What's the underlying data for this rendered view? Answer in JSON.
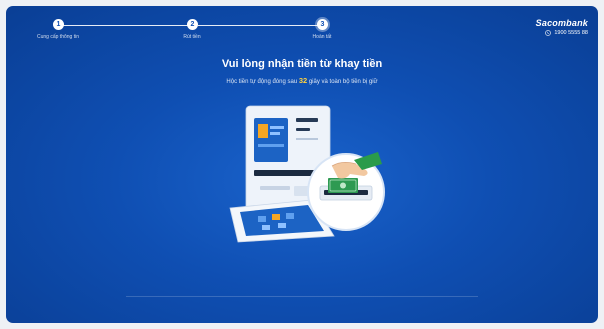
{
  "stepper": {
    "steps": [
      {
        "number": "1",
        "label": "Cung cấp thông tin"
      },
      {
        "number": "2",
        "label": "Rút tiền"
      },
      {
        "number": "3",
        "label": "Hoàn tất"
      }
    ]
  },
  "brand": {
    "name": "Sacombank",
    "hotline": "1900 5555 88"
  },
  "main": {
    "title": "Vui lòng nhận tiền từ khay tiền",
    "subtitle_before": "Hộc tiền tự động đóng sau",
    "countdown": "32",
    "subtitle_after": "giây và toàn bộ tiền bị giữ"
  },
  "colors": {
    "background": "#0f4fb3",
    "accent_countdown": "#ffd23f",
    "cash": "#2e9a52"
  },
  "icons": {
    "phone": "phone-icon",
    "atm": "atm-machine-icon",
    "cash": "cash-dispense-icon"
  }
}
